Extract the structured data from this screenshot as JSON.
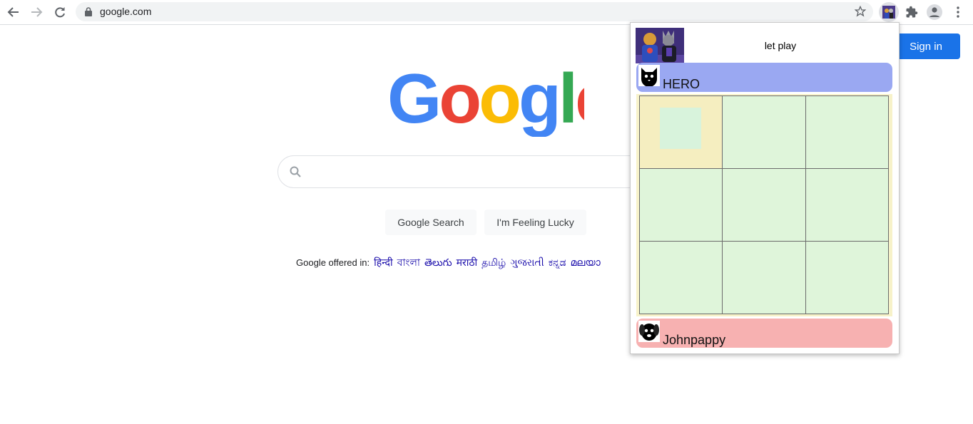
{
  "browser": {
    "url": "google.com",
    "icons": {
      "back": "arrow-left-icon",
      "forward": "arrow-right-icon",
      "reload": "reload-icon",
      "lock": "lock-icon",
      "star": "star-icon",
      "extensions": "puzzle-icon",
      "profile": "profile-icon",
      "menu": "kebab-menu-icon"
    }
  },
  "google": {
    "logo_text": "Google",
    "sign_in": "Sign in",
    "search_button": "Google Search",
    "lucky_button": "I'm Feeling Lucky",
    "offered_label": "Google offered in:",
    "languages": [
      "हिन्दी",
      "বাংলা",
      "తెలుగు",
      "मराठी",
      "தமிழ்",
      "ગુજરાતી",
      "ಕನ್ನಡ",
      "മലയാ"
    ]
  },
  "popup": {
    "title": "let play",
    "player_top": {
      "name": "HERO",
      "avatar": "cat-icon",
      "color": "#9aa8f2"
    },
    "player_bottom": {
      "name": "Johnpappy",
      "avatar": "dog-icon",
      "color": "#f7b1b1"
    },
    "board": {
      "rows": 3,
      "cols": 3,
      "cells": [
        "",
        "",
        "",
        "",
        "",
        "",
        "",
        "",
        ""
      ],
      "selected_cell": 0
    }
  },
  "colors": {
    "accent": "#1a73e8",
    "board_bg": "#f7f2c9",
    "cell_bg": "#dff5da"
  }
}
